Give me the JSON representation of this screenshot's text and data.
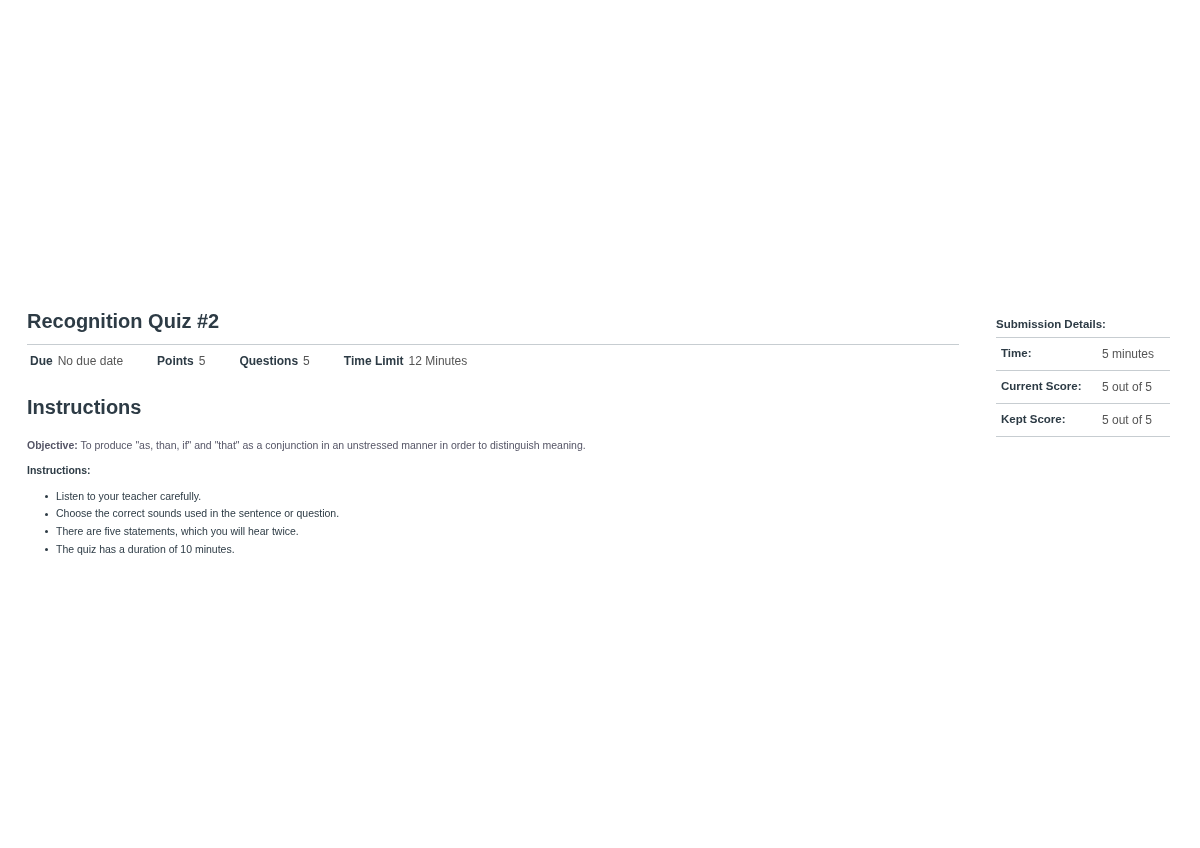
{
  "quiz": {
    "title": "Recognition Quiz #2",
    "details": [
      {
        "label": "Due",
        "value": "No due date"
      },
      {
        "label": "Points",
        "value": "5"
      },
      {
        "label": "Questions",
        "value": "5"
      },
      {
        "label": "Time Limit",
        "value": "12 Minutes"
      }
    ],
    "instructions_heading": "Instructions",
    "objective": "**Objective:** To produce \"as, than, if\" and \"that\" as a conjunction in an unstressed manner in order to distinguish meaning.",
    "instructions_label": "Instructions:",
    "instructions": [
      "Listen to your teacher carefully.",
      "Choose the correct sounds used in the sentence or question.",
      "There are five statements, which you will hear twice.",
      "The quiz has a duration of 10 minutes."
    ]
  },
  "submission": {
    "title": "Submission Details:",
    "rows": [
      {
        "label": "Time:",
        "value": "5 minutes"
      },
      {
        "label": "Current Score:",
        "value": "5 out of 5"
      },
      {
        "label": "Kept Score:",
        "value": "5 out of 5"
      }
    ]
  }
}
